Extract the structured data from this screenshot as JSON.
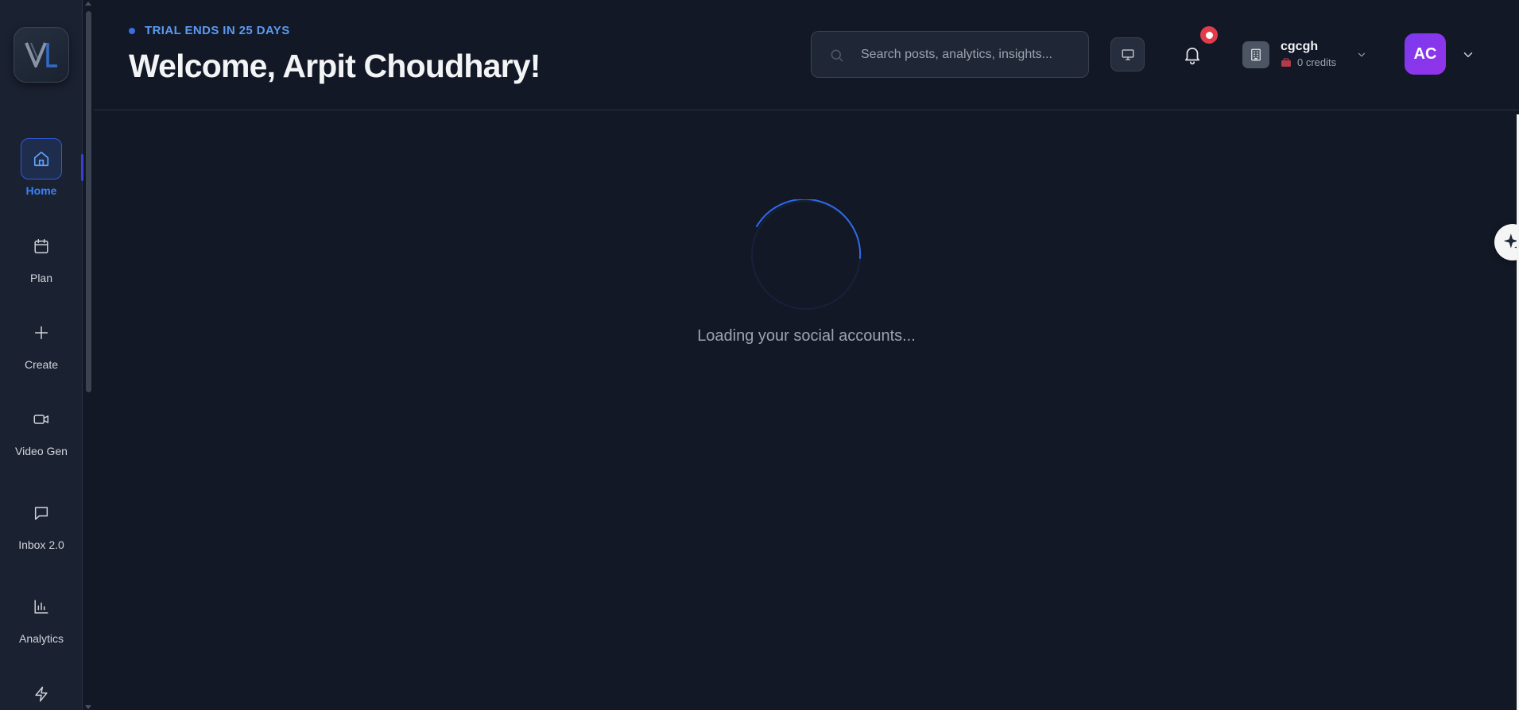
{
  "sidebar": {
    "logo_alt": "VL logo",
    "items": [
      {
        "label": "Home",
        "icon": "home-icon",
        "active": true
      },
      {
        "label": "Plan",
        "icon": "calendar-icon",
        "active": false
      },
      {
        "label": "Create",
        "icon": "plus-icon",
        "active": false
      },
      {
        "label": "Video Gen",
        "icon": "video-icon",
        "active": false
      },
      {
        "label": "Inbox 2.0",
        "icon": "message-icon",
        "active": false
      },
      {
        "label": "Analytics",
        "icon": "bar-chart-icon",
        "active": false
      },
      {
        "label": "",
        "icon": "lightning-icon",
        "active": false
      }
    ]
  },
  "header": {
    "trial_text": "TRIAL ENDS IN 25 DAYS",
    "welcome": "Welcome, Arpit Choudhary!",
    "search_placeholder": "Search posts, analytics, insights...",
    "workspace_name": "cgcgh",
    "workspace_credits": "0 credits",
    "avatar_initials": "AC"
  },
  "main": {
    "loading_text": "Loading your social accounts..."
  },
  "colors": {
    "accent": "#3b82f6",
    "background": "#121826",
    "sidebar": "#1a2131",
    "badge": "#e23b4a",
    "avatar": "#7c3aed"
  }
}
